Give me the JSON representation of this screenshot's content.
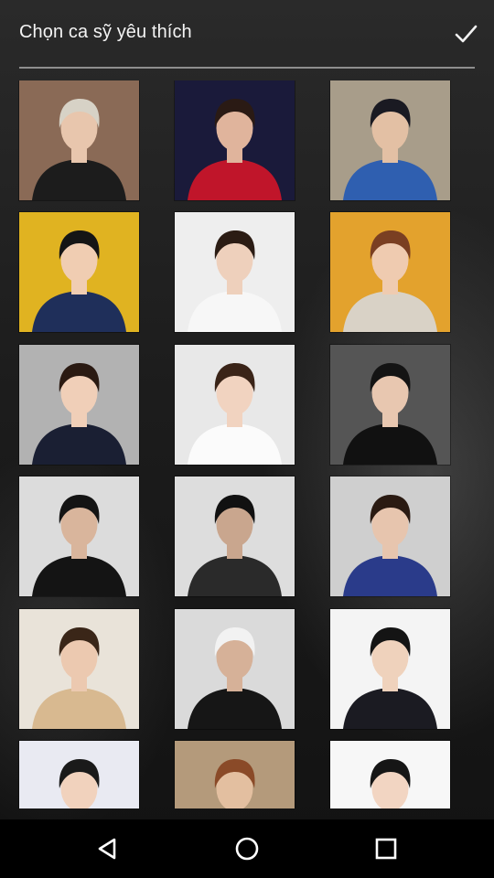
{
  "header": {
    "title": "Chọn ca sỹ yêu thích",
    "confirm_icon": "check-icon"
  },
  "grid": {
    "columns": 3,
    "items": [
      {
        "bg": "#8a6a56",
        "shirt": "#1c1c1c",
        "skin": "#e8c6ad",
        "hair": "#d7d2c6"
      },
      {
        "bg": "#1a1a3a",
        "shirt": "#c0152a",
        "skin": "#e0b49c",
        "hair": "#2a1a14"
      },
      {
        "bg": "#a89d8a",
        "shirt": "#2f5fb0",
        "skin": "#e3c0a4",
        "hair": "#1a1a22"
      },
      {
        "bg": "#e0b321",
        "shirt": "#1f2f5a",
        "skin": "#f0cdb2",
        "hair": "#151515"
      },
      {
        "bg": "#eeeeee",
        "shirt": "#f7f7f7",
        "skin": "#eed0bc",
        "hair": "#2b1c14"
      },
      {
        "bg": "#e3a22d",
        "shirt": "#d9d2c6",
        "skin": "#efcbb0",
        "hair": "#7a3f22"
      },
      {
        "bg": "#b2b2b2",
        "shirt": "#1a1f33",
        "skin": "#f0cfb8",
        "hair": "#2a1a12"
      },
      {
        "bg": "#e8e8e8",
        "shirt": "#fbfbfb",
        "skin": "#f1d3c0",
        "hair": "#3a2418"
      },
      {
        "bg": "#555555",
        "shirt": "#111111",
        "skin": "#e8c7b0",
        "hair": "#141414"
      },
      {
        "bg": "#dcdcdc",
        "shirt": "#141414",
        "skin": "#d9b59c",
        "hair": "#141414"
      },
      {
        "bg": "#dddddd",
        "shirt": "#2a2a2a",
        "skin": "#c9a68e",
        "hair": "#111111"
      },
      {
        "bg": "#cfcfcf",
        "shirt": "#2a3b8a",
        "skin": "#e7c5ae",
        "hair": "#2a1a12"
      },
      {
        "bg": "#e9e3d9",
        "shirt": "#d8b990",
        "skin": "#ecc9b0",
        "hair": "#3a2618"
      },
      {
        "bg": "#dadada",
        "shirt": "#161616",
        "skin": "#d6b198",
        "hair": "#f2f2f2"
      },
      {
        "bg": "#f4f4f4",
        "shirt": "#1b1b22",
        "skin": "#efd2bc",
        "hair": "#141414"
      },
      {
        "bg": "#e9eaf2",
        "shirt": "#1d2a55",
        "skin": "#f1d2bd",
        "hair": "#1a1a1a"
      },
      {
        "bg": "#b49a7b",
        "shirt": "#d7b99a",
        "skin": "#e3bfa0",
        "hair": "#8a4a28"
      },
      {
        "bg": "#f7f7f7",
        "shirt": "#f7f7f7",
        "skin": "#f2d5c2",
        "hair": "#161616"
      }
    ]
  },
  "navbar": {
    "back_icon": "back-icon",
    "home_icon": "home-icon",
    "recents_icon": "recents-icon"
  }
}
